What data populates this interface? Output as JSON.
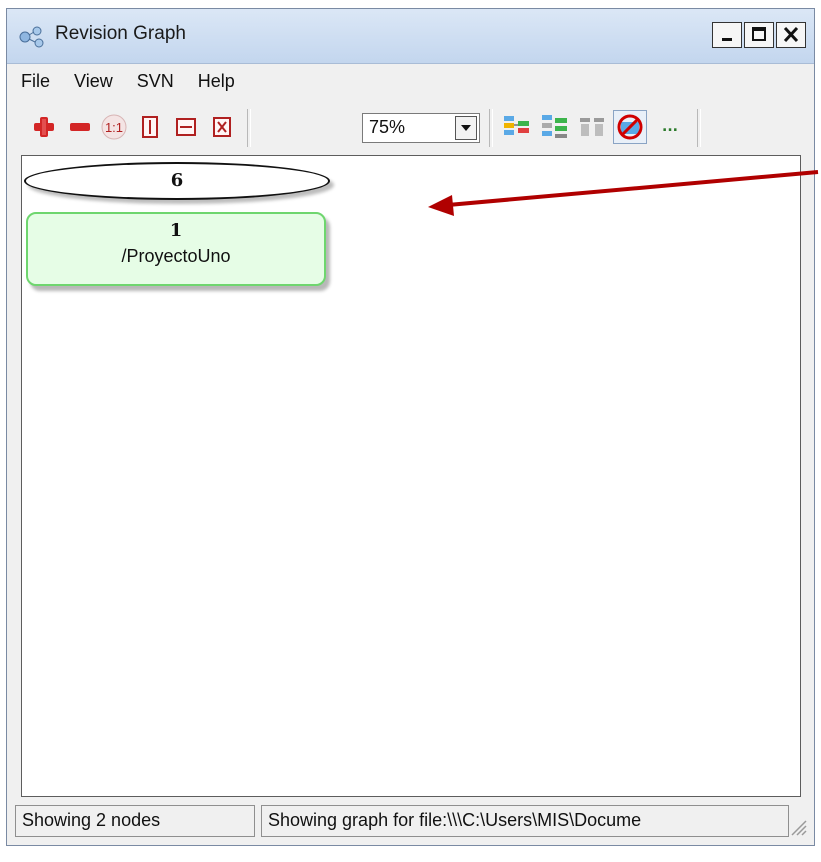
{
  "window": {
    "title": "Revision Graph",
    "icons": {
      "app": "revision-graph-icon",
      "minimize": "minimize-icon",
      "maximize": "maximize-icon",
      "close": "close-icon"
    }
  },
  "menu": [
    "File",
    "View",
    "SVN",
    "Help"
  ],
  "toolbar": {
    "buttons": [
      {
        "icon": "zoom-in-icon"
      },
      {
        "icon": "zoom-out-icon"
      },
      {
        "icon": "zoom-actual-size-icon",
        "label": "1:1"
      },
      {
        "icon": "fit-height-icon"
      },
      {
        "icon": "fit-width-icon"
      },
      {
        "icon": "fit-all-icon"
      },
      {
        "icon": "group-branches-icon"
      },
      {
        "icon": "show-head-icon"
      },
      {
        "icon": "fold-tags-icon"
      },
      {
        "icon": "remove-deleted-icon"
      },
      {
        "icon": "more-options-icon",
        "label": "..."
      }
    ],
    "zoom": {
      "value": "75%"
    }
  },
  "graph": {
    "head_revision": "6",
    "nodes": [
      {
        "revision": "1",
        "path": "/ProyectoUno",
        "color": "#e6fde6",
        "border": "#6ed66e"
      }
    ]
  },
  "status": {
    "nodes": "Showing 2 nodes",
    "graph_for": "Showing graph for file:\\\\\\C:\\Users\\MIS\\Docume"
  },
  "colors": {
    "annotation_arrow": "#b00000"
  }
}
